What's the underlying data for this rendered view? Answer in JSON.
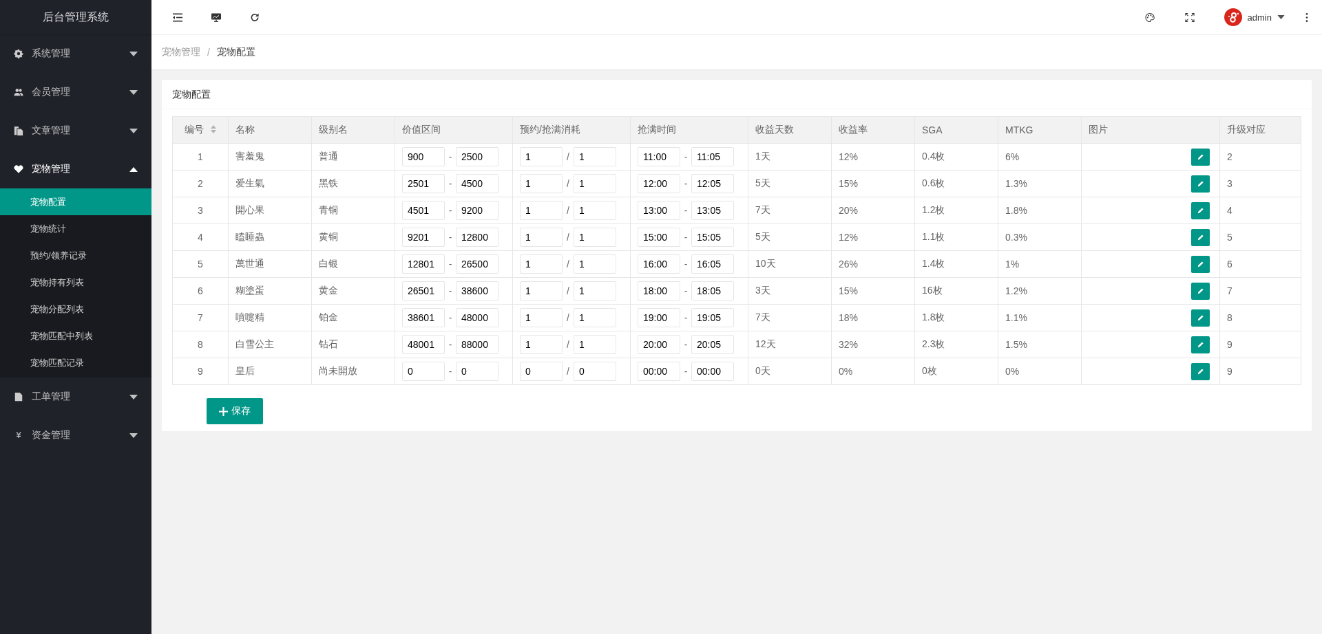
{
  "sidebar": {
    "title": "后台管理系统",
    "items": [
      {
        "label": "系统管理",
        "expanded": false
      },
      {
        "label": "会员管理",
        "expanded": false
      },
      {
        "label": "文章管理",
        "expanded": false
      },
      {
        "label": "宠物管理",
        "expanded": true,
        "children": [
          {
            "label": "宠物配置",
            "selected": true
          },
          {
            "label": "宠物统计",
            "selected": false
          },
          {
            "label": "预约/领养记录",
            "selected": false
          },
          {
            "label": "宠物持有列表",
            "selected": false
          },
          {
            "label": "宠物分配列表",
            "selected": false
          },
          {
            "label": "宠物匹配中列表",
            "selected": false
          },
          {
            "label": "宠物匹配记录",
            "selected": false
          }
        ]
      },
      {
        "label": "工单管理",
        "expanded": false
      },
      {
        "label": "资金管理",
        "expanded": false,
        "icon_text": "¥"
      }
    ]
  },
  "topbar": {
    "user": "admin"
  },
  "breadcrumb": {
    "items": [
      "宠物管理",
      "宠物配置"
    ],
    "separator": "/"
  },
  "card": {
    "title": "宠物配置",
    "table": {
      "columns": [
        {
          "label": "编号",
          "sortable": true
        },
        {
          "label": "名称",
          "sortable": false
        },
        {
          "label": "级别名",
          "sortable": false
        },
        {
          "label": "价值区间",
          "sortable": false
        },
        {
          "label": "预约/抢满消耗",
          "sortable": false
        },
        {
          "label": "抢满时间",
          "sortable": false
        },
        {
          "label": "收益天数",
          "sortable": false
        },
        {
          "label": "收益率",
          "sortable": false
        },
        {
          "label": "SGA",
          "sortable": false
        },
        {
          "label": "MTKG",
          "sortable": false
        },
        {
          "label": "图片",
          "sortable": false
        },
        {
          "label": "升级对应",
          "sortable": false
        }
      ],
      "rows": [
        {
          "id": "1",
          "name": "害羞鬼",
          "level_name": "普通",
          "value_min": "900",
          "value_sep": "-",
          "value_max": "2500",
          "cost_reserve": "1",
          "cost_sep": "/",
          "cost_grab": "1",
          "time_start": "11:00",
          "time_sep": "-",
          "time_end": "11:05",
          "days": "1天",
          "rate": "12%",
          "sga": "0.4枚",
          "mtkg": "6%",
          "upgrade": "2"
        },
        {
          "id": "2",
          "name": "爱生氣",
          "level_name": "黑铁",
          "value_min": "2501",
          "value_sep": "-",
          "value_max": "4500",
          "cost_reserve": "1",
          "cost_sep": "/",
          "cost_grab": "1",
          "time_start": "12:00",
          "time_sep": "-",
          "time_end": "12:05",
          "days": "5天",
          "rate": "15%",
          "sga": "0.6枚",
          "mtkg": "1.3%",
          "upgrade": "3"
        },
        {
          "id": "3",
          "name": "開心果",
          "level_name": "青铜",
          "value_min": "4501",
          "value_sep": "-",
          "value_max": "9200",
          "cost_reserve": "1",
          "cost_sep": "/",
          "cost_grab": "1",
          "time_start": "13:00",
          "time_sep": "-",
          "time_end": "13:05",
          "days": "7天",
          "rate": "20%",
          "sga": "1.2枚",
          "mtkg": "1.8%",
          "upgrade": "4"
        },
        {
          "id": "4",
          "name": "瞌睡蟲",
          "level_name": "黄铜",
          "value_min": "9201",
          "value_sep": "-",
          "value_max": "12800",
          "cost_reserve": "1",
          "cost_sep": "/",
          "cost_grab": "1",
          "time_start": "15:00",
          "time_sep": "-",
          "time_end": "15:05",
          "days": "5天",
          "rate": "12%",
          "sga": "1.1枚",
          "mtkg": "0.3%",
          "upgrade": "5"
        },
        {
          "id": "5",
          "name": "萬世通",
          "level_name": "白银",
          "value_min": "12801",
          "value_sep": "-",
          "value_max": "26500",
          "cost_reserve": "1",
          "cost_sep": "/",
          "cost_grab": "1",
          "time_start": "16:00",
          "time_sep": "-",
          "time_end": "16:05",
          "days": "10天",
          "rate": "26%",
          "sga": "1.4枚",
          "mtkg": "1%",
          "upgrade": "6"
        },
        {
          "id": "6",
          "name": "糊塗蛋",
          "level_name": "黄金",
          "value_min": "26501",
          "value_sep": "-",
          "value_max": "38600",
          "cost_reserve": "1",
          "cost_sep": "/",
          "cost_grab": "1",
          "time_start": "18:00",
          "time_sep": "-",
          "time_end": "18:05",
          "days": "3天",
          "rate": "15%",
          "sga": "16枚",
          "mtkg": "1.2%",
          "upgrade": "7"
        },
        {
          "id": "7",
          "name": "噴嚏精",
          "level_name": "铂金",
          "value_min": "38601",
          "value_sep": "-",
          "value_max": "48000",
          "cost_reserve": "1",
          "cost_sep": "/",
          "cost_grab": "1",
          "time_start": "19:00",
          "time_sep": "-",
          "time_end": "19:05",
          "days": "7天",
          "rate": "18%",
          "sga": "1.8枚",
          "mtkg": "1.1%",
          "upgrade": "8"
        },
        {
          "id": "8",
          "name": "白雪公主",
          "level_name": "钻石",
          "value_min": "48001",
          "value_sep": "-",
          "value_max": "88000",
          "cost_reserve": "1",
          "cost_sep": "/",
          "cost_grab": "1",
          "time_start": "20:00",
          "time_sep": "-",
          "time_end": "20:05",
          "days": "12天",
          "rate": "32%",
          "sga": "2.3枚",
          "mtkg": "1.5%",
          "upgrade": "9"
        },
        {
          "id": "9",
          "name": "皇后",
          "level_name": "尚未開放",
          "value_min": "0",
          "value_sep": "-",
          "value_max": "0",
          "cost_reserve": "0",
          "cost_sep": "/",
          "cost_grab": "0",
          "time_start": "00:00",
          "time_sep": "-",
          "time_end": "00:00",
          "days": "0天",
          "rate": "0%",
          "sga": "0枚",
          "mtkg": "0%",
          "upgrade": "9"
        }
      ]
    },
    "save_button": "保存"
  }
}
